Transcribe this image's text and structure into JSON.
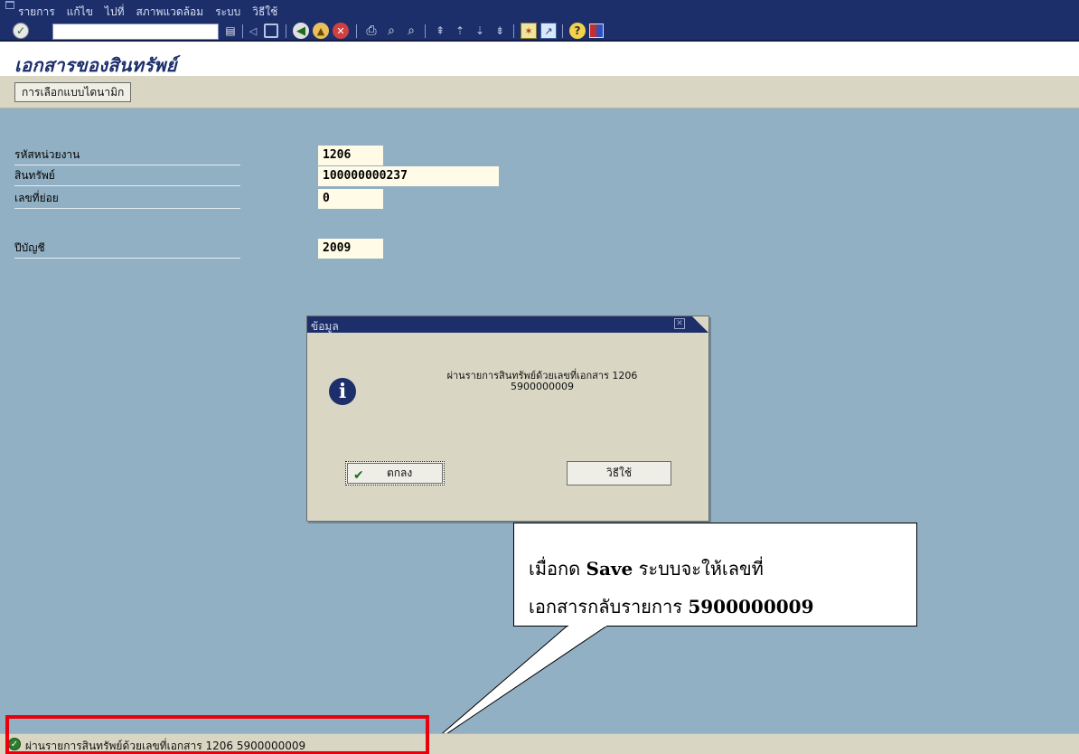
{
  "menu": [
    "รายการ",
    "แก้ไข",
    "ไปที่",
    "สภาพแวดล้อม",
    "ระบบ",
    "วิธีใช้"
  ],
  "toolbar": {
    "icons": [
      "enter-icon",
      "back-icon",
      "exit-icon",
      "cancel-icon",
      "print-icon",
      "find-icon",
      "find-next-icon",
      "first-page-icon",
      "previous-page-icon",
      "next-page-icon",
      "last-page-icon",
      "create-session-icon",
      "shortcut-icon",
      "help-icon",
      "layout-icon"
    ]
  },
  "title": "เอกสารของสินทรัพย์",
  "app_toolbar": {
    "dynamic_selection": "การเลือกแบบไดนามิก"
  },
  "fields": [
    {
      "label": "รหัสหน่วยงาน",
      "value": "1206"
    },
    {
      "label": "สินทรัพย์",
      "value": "100000000237"
    },
    {
      "label": "เลขที่ย่อย",
      "value": "0"
    },
    {
      "label": "ปีบัญชี",
      "value": "2009"
    }
  ],
  "dialog": {
    "title": "ข้อมูล",
    "message_line1": "ผ่านรายการสินทรัพย์ด้วยเลขที่เอกสาร 1206",
    "message_line2": "5900000009",
    "ok": "ตกลง",
    "help": "วิธีใช้"
  },
  "callout": {
    "line1_a": "เมื่อกด ",
    "line1_b": "Save",
    "line1_c": " ระบบจะให้เลขที่",
    "line2_a": "เอกสารกลับรายการ ",
    "line2_b": "5900000009"
  },
  "status": {
    "text": "ผ่านรายการสินทรัพย์ด้วยเลขที่เอกสาร 1206 5900000009"
  },
  "colors": {
    "menubar": "#1c2f6b",
    "workarea": "#92b0c4",
    "highlight": "#e8000d"
  }
}
